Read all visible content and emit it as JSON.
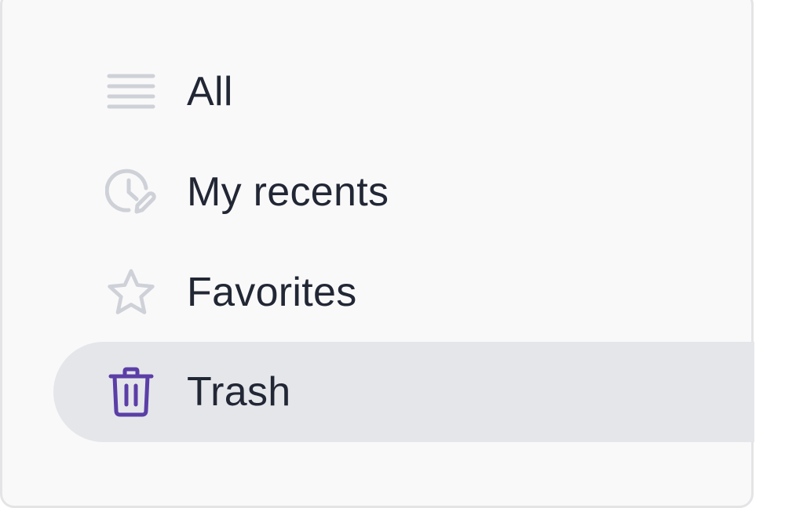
{
  "sidebar": {
    "items": [
      {
        "label": "All",
        "icon": "list-icon",
        "active": false
      },
      {
        "label": "My recents",
        "icon": "clock-edit-icon",
        "active": false
      },
      {
        "label": "Favorites",
        "icon": "star-icon",
        "active": false
      },
      {
        "label": "Trash",
        "icon": "trash-icon",
        "active": true
      }
    ]
  },
  "colors": {
    "icon_inactive": "#cfd1d8",
    "icon_active": "#5b3ea6",
    "active_bg": "#e5e6ea",
    "text": "#222735",
    "panel_bg": "#f9f9f9"
  }
}
